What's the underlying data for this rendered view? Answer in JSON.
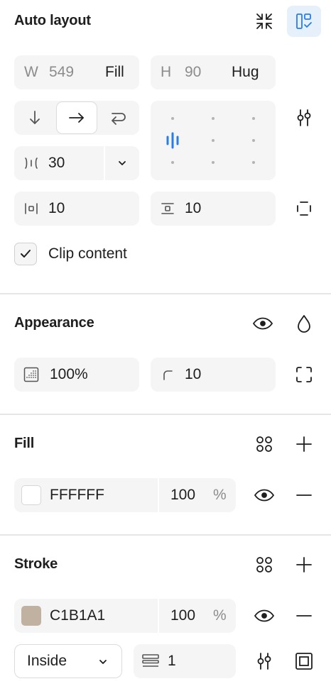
{
  "auto_layout": {
    "title": "Auto layout",
    "width_label": "W",
    "width_value": "549",
    "width_mode": "Fill",
    "height_label": "H",
    "height_value": "90",
    "height_mode": "Hug",
    "gap_value": "30",
    "padding_horizontal": "10",
    "padding_vertical": "10",
    "clip_content_label": "Clip content",
    "clip_content_checked": true
  },
  "appearance": {
    "title": "Appearance",
    "opacity": "100%",
    "corner_radius": "10"
  },
  "fill": {
    "title": "Fill",
    "hex": "FFFFFF",
    "swatch_color": "#FFFFFF",
    "opacity": "100",
    "percent": "%"
  },
  "stroke": {
    "title": "Stroke",
    "hex": "C1B1A1",
    "swatch_color": "#C1B1A1",
    "opacity": "100",
    "percent": "%",
    "position": "Inside",
    "weight": "1"
  },
  "colors": {
    "accent": "#2a7de1",
    "accent_bg": "#e5f0fb",
    "field_bg": "#f5f5f5"
  }
}
